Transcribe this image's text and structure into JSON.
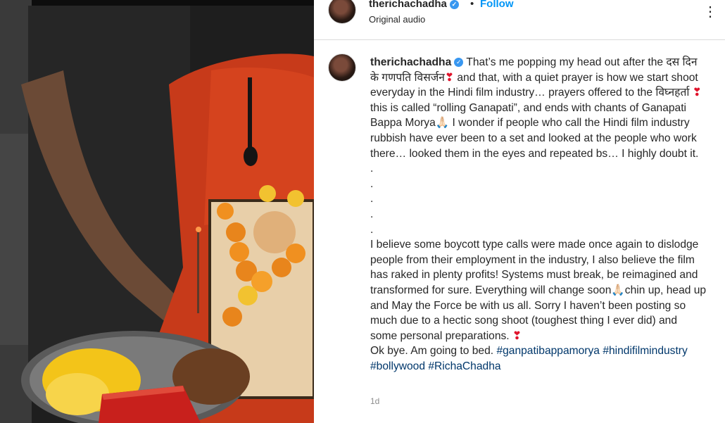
{
  "post": {
    "username": "therichachadha",
    "verified_glyph": "✓",
    "separator": "•",
    "follow_label": "Follow",
    "audio_label": "Original audio",
    "more_label": "⋮",
    "timestamp": "1d"
  },
  "caption": {
    "intro": "That’s me popping my head out after the दस दिन के गणपति विसर्जन",
    "heart": "❣",
    "line2": " and that, with a quiet prayer is how we start shoot everyday in the Hindi film industry… prayers offered to the विघ्नहर्ता ",
    "line3": "this is called “rolling Ganapati”, and ends with chants of Ganapati Bappa Morya🙏🏻 I wonder if people who call the Hindi film industry rubbish have ever been to a set and looked at the people who work there… looked them in the eyes and repeated bs… I highly doubt it.",
    "dots": [
      ".",
      ".",
      ".",
      ".",
      "."
    ],
    "para2": "I believe some boycott type calls were made once again to dislodge people from their employment in the industry, I also believe the film has raked in plenty profits! Systems must break, be reimagined and transformed for sure. Everything will change soon🙏🏻chin up, head up and May the Force be with us all. Sorry I haven’t been posting so much due to a hectic song shoot (toughest thing I ever did) and some personal preparations. ",
    "outro": "Ok bye. Am going to bed. ",
    "hashtags": [
      "#ganpatibappamorya",
      "#hindifilmindustry",
      "#bollywood",
      "#RichaChadha"
    ]
  },
  "colors": {
    "follow": "#0095f6",
    "hashtag": "#00376b",
    "verified": "#3897f0",
    "heart": "#e0132b"
  },
  "icons": {
    "verified": "verified-badge-icon",
    "more": "more-options-icon"
  }
}
